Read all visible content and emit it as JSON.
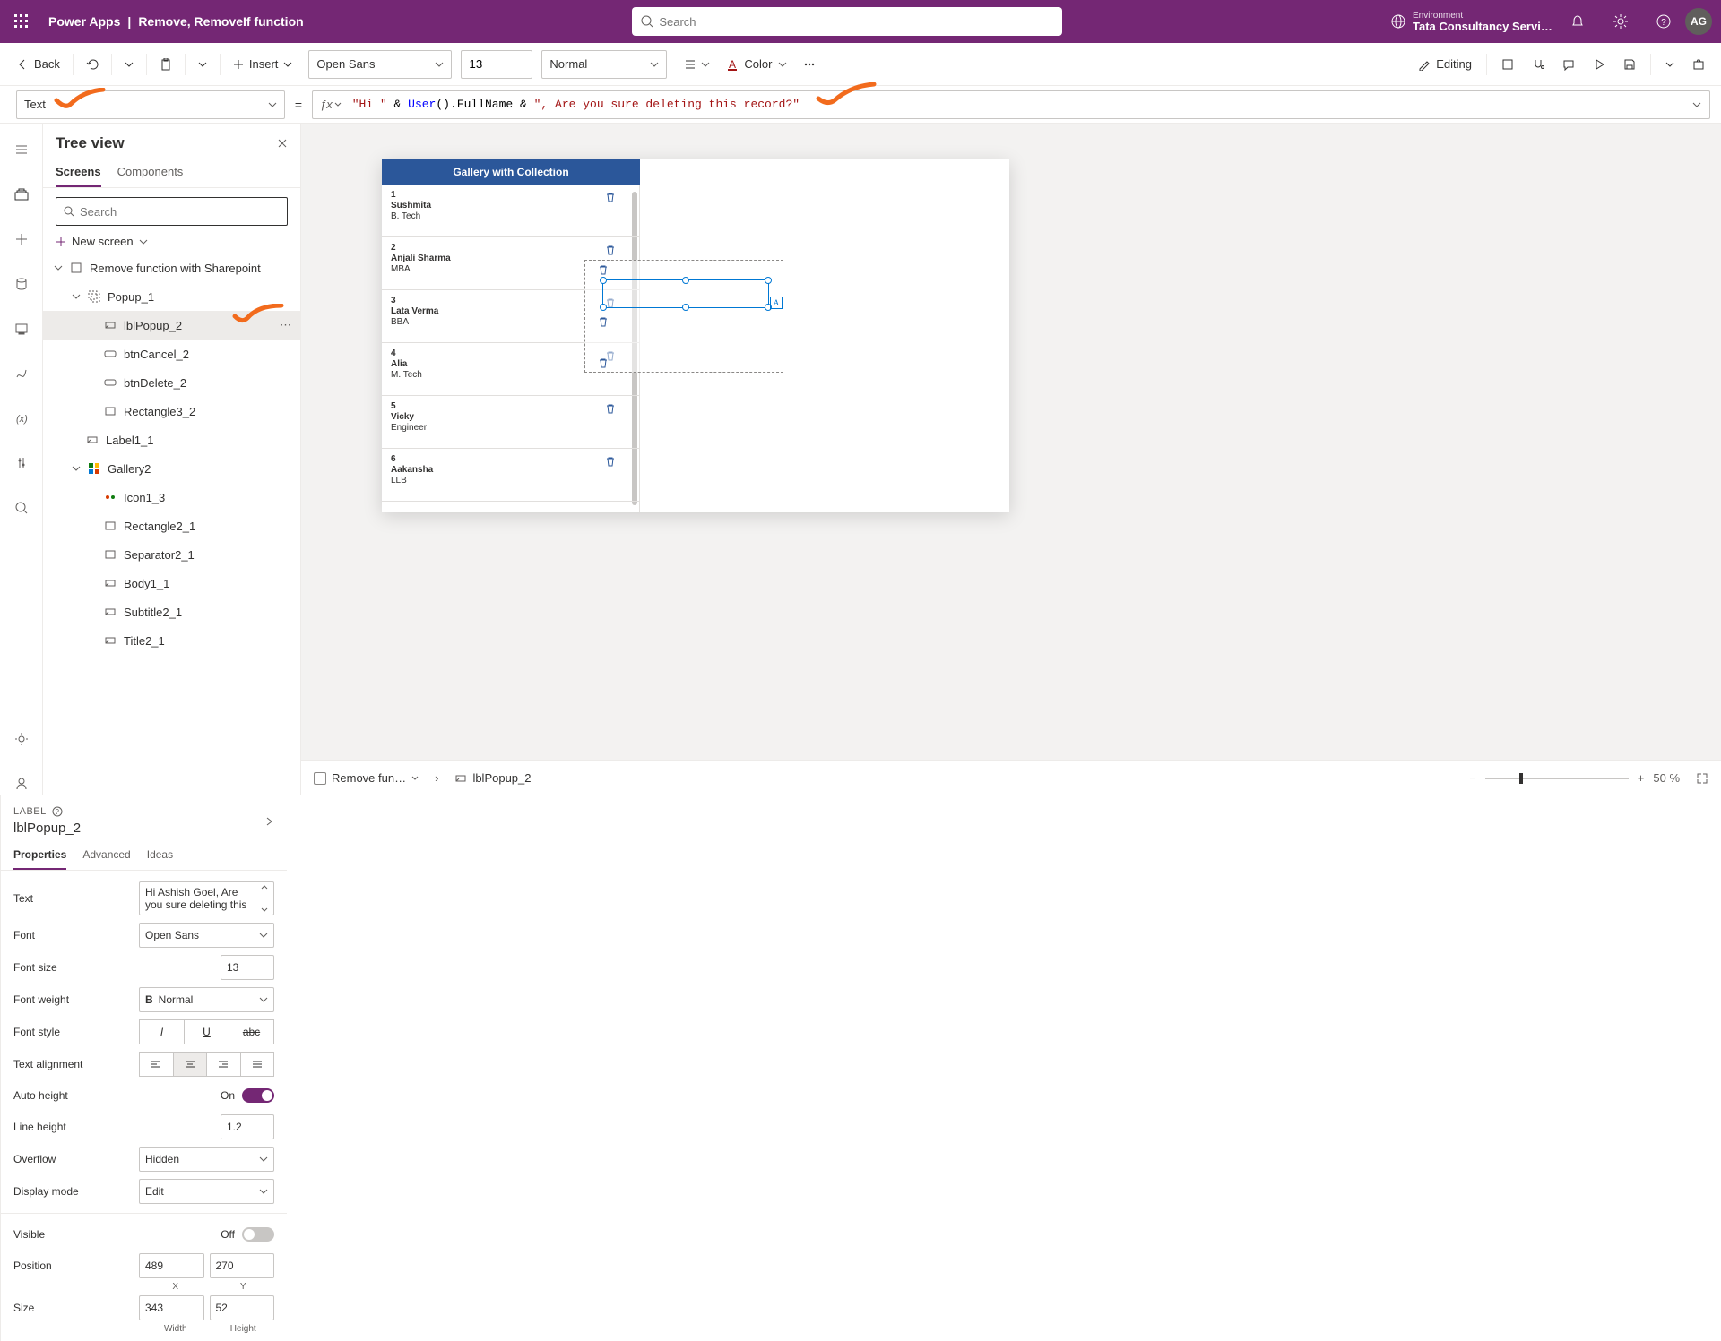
{
  "header": {
    "app": "Power Apps",
    "sep": "|",
    "doc": "Remove, RemoveIf function",
    "search_placeholder": "Search",
    "env_label": "Environment",
    "env_name": "Tata Consultancy Servic…",
    "avatar": "AG"
  },
  "toolbar": {
    "back": "Back",
    "insert": "Insert",
    "font": "Open Sans",
    "size": "13",
    "weight": "Normal",
    "color": "Color",
    "editing": "Editing"
  },
  "formula": {
    "property": "Text",
    "fx_tokens": {
      "s1": "\"Hi \"",
      "op1": " & ",
      "fn": "User",
      "paren": "()",
      "mem": ".FullName",
      "op2": " & ",
      "s2": "\", Are you sure deleting this record?\""
    }
  },
  "tree": {
    "title": "Tree view",
    "tab_screens": "Screens",
    "tab_components": "Components",
    "search_placeholder": "Search",
    "new_screen": "New screen",
    "nodes": {
      "screen": "Remove function with Sharepoint",
      "popup": "Popup_1",
      "lbl": "lblPopup_2",
      "cancel": "btnCancel_2",
      "delete": "btnDelete_2",
      "rect3": "Rectangle3_2",
      "label1": "Label1_1",
      "gallery": "Gallery2",
      "icon1": "Icon1_3",
      "rect2": "Rectangle2_1",
      "sep": "Separator2_1",
      "body": "Body1_1",
      "sub": "Subtitle2_1",
      "title": "Title2_1"
    }
  },
  "canvas": {
    "gallery_title": "Gallery with Collection",
    "items": [
      {
        "id": "1",
        "name": "Sushmita",
        "qual": "B. Tech"
      },
      {
        "id": "2",
        "name": "Anjali Sharma",
        "qual": "MBA"
      },
      {
        "id": "3",
        "name": "Lata Verma",
        "qual": "BBA"
      },
      {
        "id": "4",
        "name": "Alia",
        "qual": "M. Tech"
      },
      {
        "id": "5",
        "name": "Vicky",
        "qual": "Engineer"
      },
      {
        "id": "6",
        "name": "Aakansha",
        "qual": "LLB"
      }
    ]
  },
  "breadcrumb": {
    "screen": "Remove fun…",
    "control": "lblPopup_2",
    "zoom": "50",
    "pct": "%"
  },
  "proppanel": {
    "type": "LABEL",
    "name": "lblPopup_2",
    "tab_props": "Properties",
    "tab_adv": "Advanced",
    "tab_ideas": "Ideas",
    "rows": {
      "text_label": "Text",
      "text_value": "Hi Ashish Goel, Are you sure deleting this",
      "font_label": "Font",
      "font_value": "Open Sans",
      "size_label": "Font size",
      "size_value": "13",
      "weight_label": "Font weight",
      "weight_value": "Normal",
      "style_label": "Font style",
      "align_label": "Text alignment",
      "auto_label": "Auto height",
      "auto_state": "On",
      "lh_label": "Line height",
      "lh_value": "1.2",
      "ovf_label": "Overflow",
      "ovf_value": "Hidden",
      "mode_label": "Display mode",
      "mode_value": "Edit",
      "vis_label": "Visible",
      "vis_state": "Off",
      "pos_label": "Position",
      "pos_x": "489",
      "pos_y": "270",
      "pos_x_hint": "X",
      "pos_y_hint": "Y",
      "size_label2": "Size",
      "size_w": "343",
      "size_h": "52",
      "size_w_hint": "Width",
      "size_h_hint": "Height"
    }
  }
}
